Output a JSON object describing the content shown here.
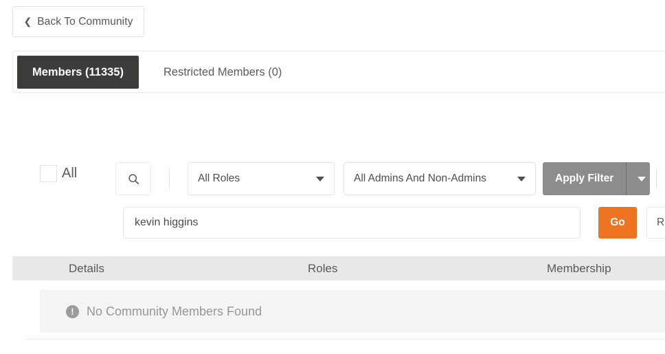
{
  "back_button": {
    "label": "Back To Community",
    "icon": "chevron-left-icon",
    "glyph": "❮"
  },
  "tabs": [
    {
      "label": "Members (11335)",
      "active": true
    },
    {
      "label": "Restricted Members (0)",
      "active": false
    }
  ],
  "filters": {
    "select_all": {
      "label": "All",
      "checked": false
    },
    "search_icon": "search-icon",
    "role_select": {
      "value": "All Roles"
    },
    "admin_select": {
      "value": "All Admins And Non-Admins"
    },
    "apply_button": {
      "label": "Apply Filter",
      "color": "#8c8c8c"
    }
  },
  "search": {
    "value": "kevin higgins",
    "placeholder": "",
    "go_label": "Go",
    "go_color": "#ec7422",
    "reset_label": "Reset"
  },
  "table": {
    "columns": [
      "Details",
      "Roles",
      "Membership"
    ],
    "empty_message": "No Community Members Found",
    "empty_icon": "exclamation-circle-icon",
    "rows": []
  }
}
